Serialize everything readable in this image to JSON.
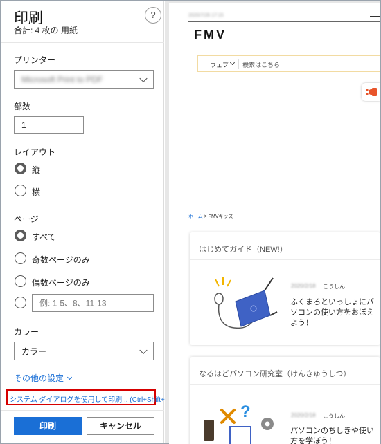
{
  "panel": {
    "title": "印刷",
    "subtitle": "合計: 4 枚の 用紙",
    "help": "?",
    "printer_label": "プリンター",
    "printer_value": "Microsoft Print to PDF",
    "copies_label": "部数",
    "copies_value": "1",
    "layout_label": "レイアウト",
    "layout_options": [
      "縦",
      "横"
    ],
    "pages_label": "ページ",
    "pages_options": [
      "すべて",
      "奇数ページのみ",
      "偶数ページのみ"
    ],
    "pages_custom_placeholder": "例: 1-5、8、11-13",
    "color_label": "カラー",
    "color_value": "カラー",
    "more_settings": "その他の設定",
    "system_dialog": "システム ダイアログを使用して印刷... (Ctrl+Shift+P)",
    "print_button": "印刷",
    "cancel_button": "キャンセル"
  },
  "preview": {
    "date": "2020/7/26 17:15",
    "logo": "FMV",
    "search_scope": "ウェブ",
    "search_placeholder": "検索はこちら",
    "breadcrumb_home": "ホーム",
    "breadcrumb_sep": " > ",
    "breadcrumb_current": "FMVキッズ",
    "cards": [
      {
        "title": "はじめてガイド（NEW!）",
        "date": "2020/2/18",
        "user": "こうしん",
        "desc": "ふくまろといっしょにパソコンの使い方をおぼえよう！"
      },
      {
        "title": "なるほどパソコン研究室（けんきゅうしつ）",
        "date": "2020/2/18",
        "user": "こうしん",
        "desc": "パソコンのちしきや使い方を学ぼう！"
      }
    ]
  },
  "colors": {
    "accent": "#1a6fd6",
    "highlight_border": "#d60000",
    "share_icon": "#e8552b",
    "search_border": "#f2dba2"
  }
}
